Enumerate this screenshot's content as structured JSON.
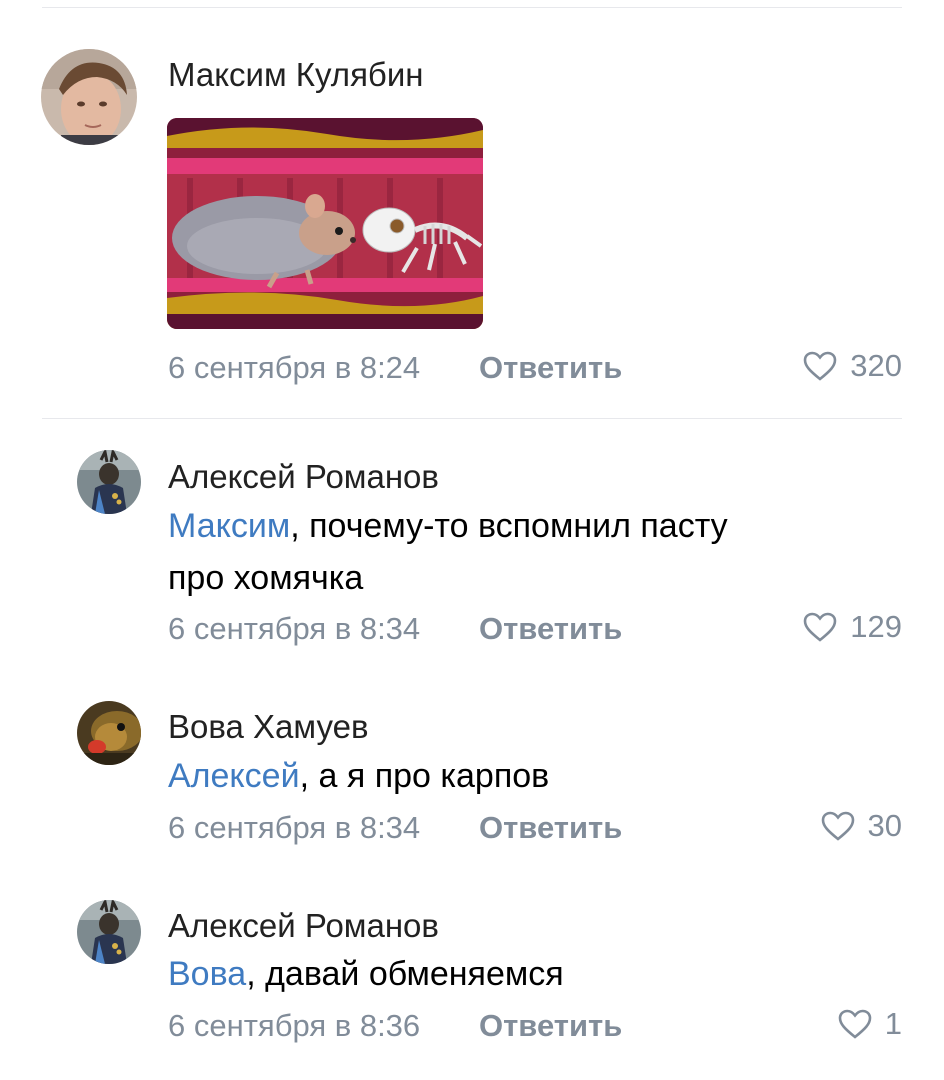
{
  "comments": [
    {
      "author": "Максим Кулябин",
      "date": "6 сентября в 8:24",
      "reply_label": "Ответить",
      "likes": "320",
      "has_image": true,
      "image_description": "sticker-hamster-and-skeleton"
    },
    {
      "author": "Алексей Романов",
      "mention": "Максим",
      "text_rest": ", почему-то вспомнил пасту",
      "text_line2": "про хомячка",
      "date": "6 сентября в 8:34",
      "reply_label": "Ответить",
      "likes": "129"
    },
    {
      "author": "Вова Хамуев",
      "mention": "Алексей",
      "text_rest": ", а я про карпов",
      "date": "6 сентября в 8:34",
      "reply_label": "Ответить",
      "likes": "30"
    },
    {
      "author": "Алексей Романов",
      "mention": "Вова",
      "text_rest": ", давай обменяемся",
      "date": "6 сентября в 8:36",
      "reply_label": "Ответить",
      "likes": "1"
    }
  ],
  "colors": {
    "mention": "#3f7bc1",
    "meta": "#818c99",
    "author": "#222222",
    "divider": "#e7e8ec"
  },
  "icons": {
    "like": "heart-outline-icon"
  }
}
